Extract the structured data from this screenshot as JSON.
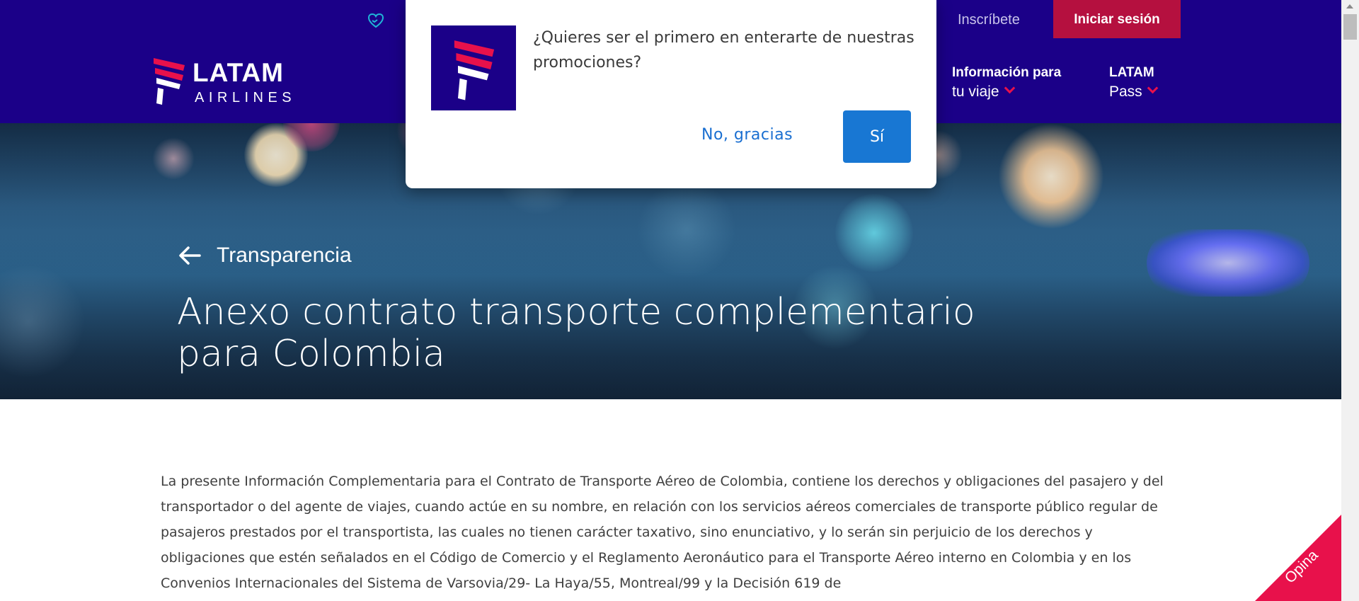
{
  "topbar": {
    "util_link": "",
    "signup_label": "Inscríbete",
    "login_label": "Iniciar sesión"
  },
  "header": {
    "logo_text": "LATAM",
    "logo_subtext": "AIRLINES",
    "nav": [
      {
        "line1": "Información para",
        "line2": "tu viaje"
      },
      {
        "line1": "LATAM",
        "line2": "Pass"
      }
    ]
  },
  "hero": {
    "breadcrumb": "Transparencia",
    "title": "Anexo contrato transporte complementario para Colombia"
  },
  "content": {
    "paragraph": "La presente Información Complementaria para el Contrato de Transporte Aéreo de Colombia, contiene los derechos y obligaciones del pasajero y del transportador o del agente de viajes, cuando actúe en su nombre, en relación con los servicios aéreos comerciales de transporte público regular de pasajeros prestados por el transportista, las cuales no tienen carácter taxativo, sino enunciativo, y lo serán sin perjuicio de los derechos y obligaciones que estén señalados en el Código de Comercio y el Reglamento Aeronáutico para el Transporte Aéreo interno en Colombia y en los Convenios Internacionales del Sistema de Varsovia/29- La Haya/55, Montreal/99 y la Decisión 619 de"
  },
  "popup": {
    "message": "¿Quieres ser el primero en enterarte de nuestras promociones?",
    "decline_label": "No, gracias",
    "accept_label": "Sí"
  },
  "feedback": {
    "label": "Opina"
  },
  "colors": {
    "brand_indigo": "#1b0088",
    "brand_coral": "#e8114b",
    "login_red": "#b5103f",
    "action_blue": "#1877d3",
    "link_blue": "#1a6fd1"
  },
  "icons": [
    "heart-hands-icon",
    "latam-logo-icon",
    "chevron-down-icon",
    "arrow-left-icon"
  ]
}
